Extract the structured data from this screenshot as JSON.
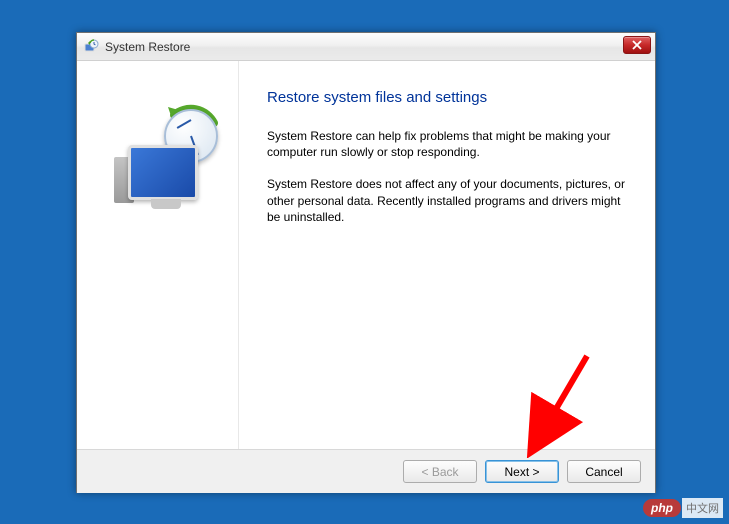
{
  "window": {
    "title": "System Restore"
  },
  "main": {
    "heading": "Restore system files and settings",
    "paragraph1": "System Restore can help fix problems that might be making your computer run slowly or stop responding.",
    "paragraph2": "System Restore does not affect any of your documents, pictures, or other personal data. Recently installed programs and drivers might be uninstalled."
  },
  "buttons": {
    "back": "< Back",
    "next": "Next >",
    "cancel": "Cancel"
  },
  "watermark": {
    "badge": "php",
    "text": "中文网"
  }
}
